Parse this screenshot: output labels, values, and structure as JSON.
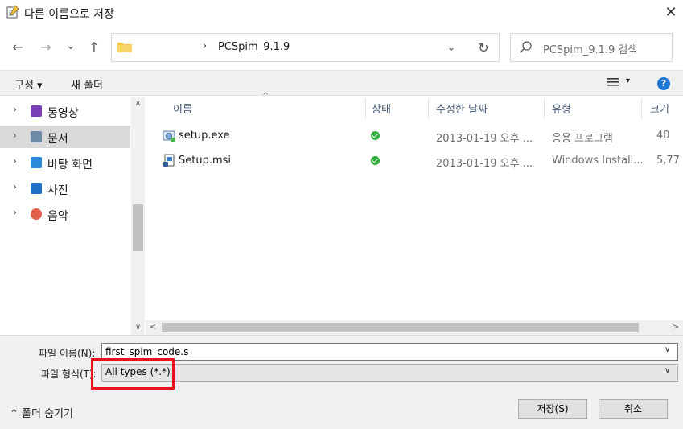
{
  "window": {
    "title": "다른 이름으로 저장"
  },
  "nav": {
    "back": "←",
    "forward": "→",
    "recent": "⌄",
    "up": "↑",
    "address_sep": "›",
    "address": "PCSpim_9.1.9",
    "address_drop": "⌄",
    "refresh": "↻",
    "search_placeholder": "PCSpim_9.1.9 검색"
  },
  "toolbar": {
    "organize": "구성 ▾",
    "new_folder": "새 폴더",
    "view_drop": "▾",
    "help": "?"
  },
  "sidebar": {
    "items": [
      {
        "label": "동영상",
        "icon": "video-icon",
        "color": "#7b3fb8"
      },
      {
        "label": "문서",
        "icon": "document-icon",
        "color": "#6f8aa8",
        "selected": true
      },
      {
        "label": "바탕 화면",
        "icon": "desktop-icon",
        "color": "#2a8ad8"
      },
      {
        "label": "사진",
        "icon": "pictures-icon",
        "color": "#1f6fc4"
      },
      {
        "label": "음악",
        "icon": "music-icon",
        "color": "#e0604a"
      }
    ]
  },
  "list": {
    "columns": [
      "이름",
      "상태",
      "수정한 날짜",
      "유형",
      "크기"
    ],
    "rows": [
      {
        "name": "setup.exe",
        "date": "2013-01-19 오후 ...",
        "type": "응용 프로그램",
        "size": "40"
      },
      {
        "name": "Setup.msi",
        "date": "2013-01-19 오후 ...",
        "type": "Windows Install...",
        "size": "5,77"
      }
    ]
  },
  "bottom": {
    "filename_label": "파일 이름(N):",
    "filename_value": "first_spim_code.s",
    "filetype_label": "파일 형식(T):",
    "filetype_value": "All types (*.*)",
    "hide_folders": "⌃  폴더 숨기기",
    "save": "저장(S)",
    "cancel": "취소"
  },
  "colors": {
    "accent": "#1d77d5",
    "highlight": "#e8121a",
    "status_ok": "#2fae3b",
    "selected": "#d9d9d9"
  }
}
